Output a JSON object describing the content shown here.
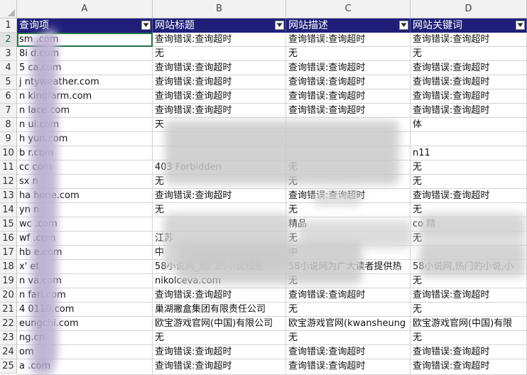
{
  "column_headers": [
    "A",
    "B",
    "C",
    "D"
  ],
  "header_row": {
    "row_number": "1",
    "cells": [
      "查询项",
      "网站标题",
      "网站描述",
      "网站关键词"
    ]
  },
  "rows": [
    {
      "n": "2",
      "a": "sm      .com",
      "b": "查询错误:查询超时",
      "c": "查询错误:查询超时",
      "d": "查询错误:查询超时"
    },
    {
      "n": "3",
      "a": "8i      d.com",
      "b": "无",
      "c": "无",
      "d": "无"
    },
    {
      "n": "4",
      "a": "5      ca.com",
      "b": "查询错误:查询超时",
      "c": "查询错误:查询超时",
      "d": "查询错误:查询超时"
    },
    {
      "n": "5",
      "a": "j      ntyweather.com",
      "b": "查询错误:查询超时",
      "c": "查询错误:查询超时",
      "d": "查询错误:查询超时"
    },
    {
      "n": "6",
      "a": "n      kingfarm.com",
      "b": "查询错误:查询超时",
      "c": "查询错误:查询超时",
      "d": "查询错误:查询超时"
    },
    {
      "n": "7",
      "a": "n      lace.com",
      "b": "查询错误:查询超时",
      "c": "查询错误:查询超时",
      "d": "查询错误:查询超时"
    },
    {
      "n": "8",
      "a": "n      ui.com",
      "b": "天",
      "c": "",
      "d": "                    体"
    },
    {
      "n": "9",
      "a": "h      yun.com",
      "b": "",
      "c": "",
      "d": ""
    },
    {
      "n": "10",
      "a": "b      r.com",
      "b": "",
      "c": "",
      "d": "                   n11"
    },
    {
      "n": "11",
      "a": "cc      com",
      "b": "403 Forbidden",
      "c": "无",
      "d": "无"
    },
    {
      "n": "12",
      "a": "sx      n",
      "b": "无",
      "c": "无",
      "d": "无"
    },
    {
      "n": "13",
      "a": "ha      hone.com",
      "b": "查询错误:查询超时",
      "c": "查询错误:查询超时",
      "d": "查询错误:查询超时"
    },
    {
      "n": "14",
      "a": "yn      n",
      "b": "无",
      "c": "无",
      "d": "无"
    },
    {
      "n": "15",
      "a": "wc      .com",
      "b": "",
      "c": "精品",
      "d": "co 精"
    },
    {
      "n": "16",
      "a": "wf      .com",
      "b": "江苏",
      "c": "无",
      "d": "无"
    },
    {
      "n": "17",
      "a": "hb      e.com",
      "b": "中",
      "c": "中",
      "d": ""
    },
    {
      "n": "18",
      "a": "x'      et",
      "b": "58小说网_热门的小说线免",
      "c": "58小说网为广大读者提供热",
      "d": "58小说网,热门的小说,小"
    },
    {
      "n": "19",
      "a": "n      va.com",
      "b": "nikolceva.com",
      "c": "无",
      "d": "无"
    },
    {
      "n": "20",
      "a": "n      fari.com",
      "b": "查询错误:查询超时",
      "c": "查询错误:查询超时",
      "d": "查询错误:查询超时"
    },
    {
      "n": "21",
      "a": "4      0110.com",
      "b": "巢湖撇盒集团有限责任公司",
      "c": "无",
      "d": "无"
    },
    {
      "n": "22",
      "a": "       eungchi.com",
      "b": "欧宝游戏官网(中国)有限公司",
      "c": "欧宝游戏官网(kwansheung",
      "d": "欧宝游戏官网(中国)有限"
    },
    {
      "n": "23",
      "a": "       ng.cn",
      "b": "无",
      "c": "无",
      "d": "无"
    },
    {
      "n": "24",
      "a": "       om",
      "b": "查询错误:查询超时",
      "c": "查询错误:查询超时",
      "d": "查询错误:查询超时"
    },
    {
      "n": "25",
      "a": "a      .com",
      "b": "查询错误:查询超时",
      "c": "查询错误:查询超时",
      "d": "查询错误:查询超时"
    }
  ]
}
